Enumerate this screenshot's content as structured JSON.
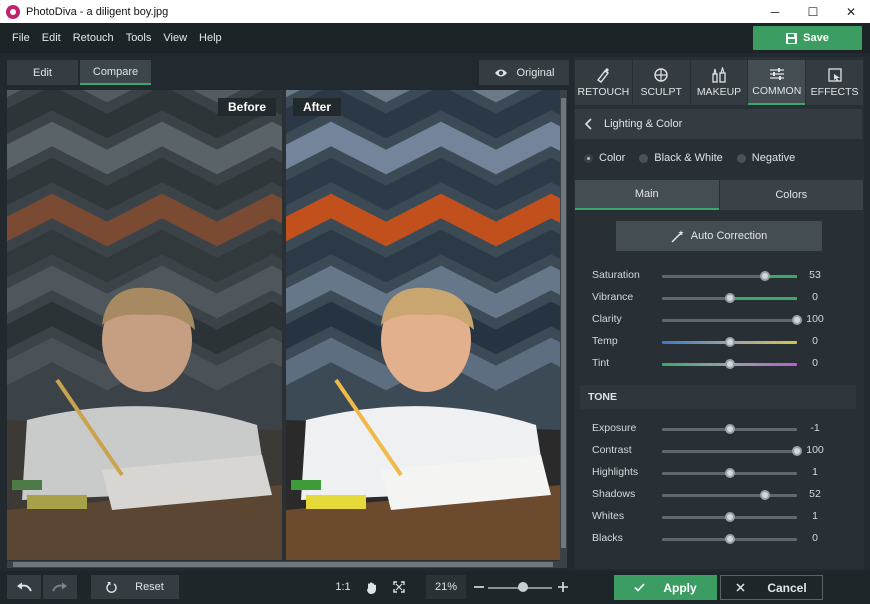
{
  "window": {
    "title": "PhotoDiva - a diligent boy.jpg",
    "controls": [
      "─",
      "☐",
      "✕"
    ]
  },
  "menu": [
    "File",
    "Edit",
    "Retouch",
    "Tools",
    "View",
    "Help"
  ],
  "save_label": "Save",
  "modes": {
    "edit": "Edit",
    "compare": "Compare",
    "active": "Compare",
    "original": "Original"
  },
  "compare": {
    "before_label": "Before",
    "after_label": "After"
  },
  "tools": [
    {
      "label": "RETOUCH",
      "icon": "retouch-brush-icon"
    },
    {
      "label": "SCULPT",
      "icon": "sculpt-icon"
    },
    {
      "label": "MAKEUP",
      "icon": "makeup-icon"
    },
    {
      "label": "COMMON",
      "icon": "sliders-icon",
      "active": true
    },
    {
      "label": "EFFECTS",
      "icon": "effects-icon"
    }
  ],
  "section": {
    "back_icon": "chevron-left-icon",
    "title": "Lighting & Color"
  },
  "color_modes": {
    "color": "Color",
    "bw": "Black & White",
    "negative": "Negative",
    "selected": "Color"
  },
  "subtabs": {
    "main": "Main",
    "colors": "Colors",
    "active": "Main"
  },
  "auto_correction": "Auto Correction",
  "sliders": [
    {
      "label": "Saturation",
      "value": "53",
      "level": 0.76,
      "style": "green"
    },
    {
      "label": "Vibrance",
      "value": "0",
      "level": 0.5,
      "style": "green-right"
    },
    {
      "label": "Clarity",
      "value": "100",
      "level": 1.0,
      "style": "plain"
    },
    {
      "label": "Temp",
      "value": "0",
      "level": 0.5,
      "style": "temp"
    },
    {
      "label": "Tint",
      "value": "0",
      "level": 0.5,
      "style": "tint"
    }
  ],
  "tone": {
    "title": "TONE",
    "sliders": [
      {
        "label": "Exposure",
        "value": "-1",
        "level": 0.5
      },
      {
        "label": "Contrast",
        "value": "100",
        "level": 1.0
      },
      {
        "label": "Highlights",
        "value": "1",
        "level": 0.5
      },
      {
        "label": "Shadows",
        "value": "52",
        "level": 0.76
      },
      {
        "label": "Whites",
        "value": "1",
        "level": 0.5
      },
      {
        "label": "Blacks",
        "value": "0",
        "level": 0.5
      }
    ]
  },
  "bottom": {
    "reset": "Reset",
    "one_to_one": "1:1",
    "zoom": "21%",
    "zoom_level": 0.55,
    "apply": "Apply",
    "cancel": "Cancel"
  },
  "colors": {
    "accent": "#3aa86b",
    "save": "#3c9d63"
  }
}
